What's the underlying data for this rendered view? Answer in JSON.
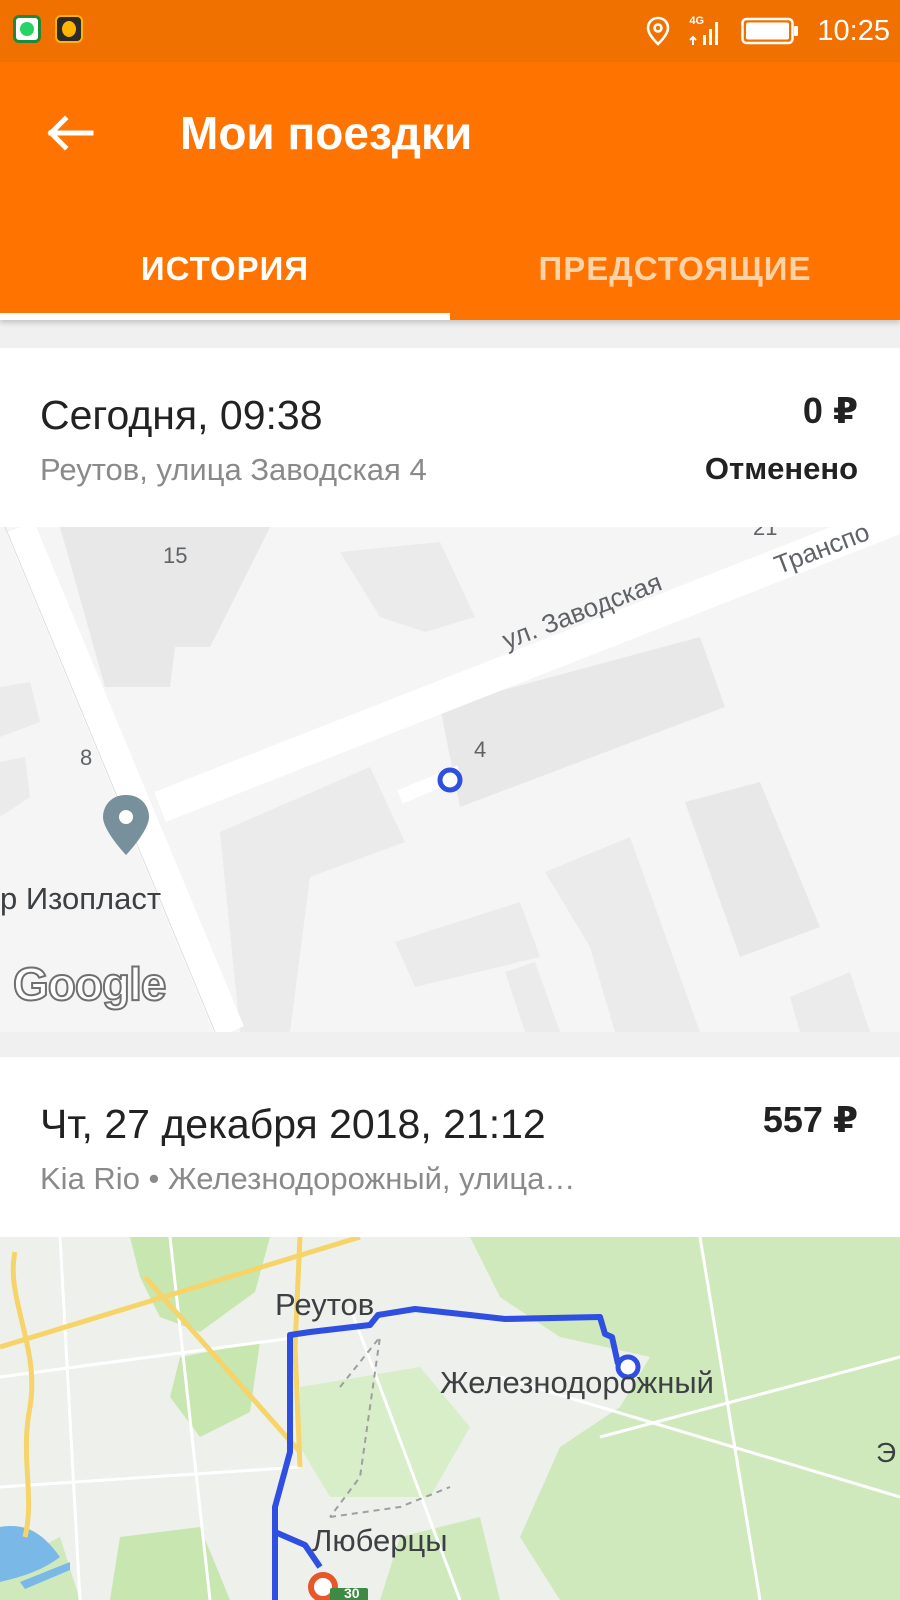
{
  "status_bar": {
    "time": "10:25",
    "network": "4G",
    "icons": [
      "whatsapp-icon",
      "taxi-app-icon",
      "location-icon",
      "signal-icon",
      "battery-icon"
    ]
  },
  "toolbar": {
    "title": "Мои поездки",
    "back_icon": "arrow-left-icon",
    "color": "#ff7300"
  },
  "tabs": [
    {
      "label": "ИСТОРИЯ",
      "active": true
    },
    {
      "label": "ПРЕДСТОЯЩИЕ",
      "active": false
    }
  ],
  "trips": [
    {
      "datetime": "Сегодня, 09:38",
      "address": "Реутов, улица Заводская 4",
      "price": "0 ₽",
      "status": "Отменено",
      "map": {
        "street": "ул. Заводская",
        "street2": "Транспо",
        "numbers": [
          "15",
          "8",
          "4",
          "21"
        ],
        "poi": "р Изопласт",
        "logo": "Google"
      }
    },
    {
      "datetime": "Чт, 27 декабря 2018, 21:12",
      "subtitle": "Kia Rio • Железнодорожный, улица…",
      "price": "557 ₽",
      "map": {
        "cities": [
          "Реутов",
          "Железнодорожный",
          "Люберцы",
          "Э"
        ],
        "road_badge": "30"
      }
    }
  ]
}
